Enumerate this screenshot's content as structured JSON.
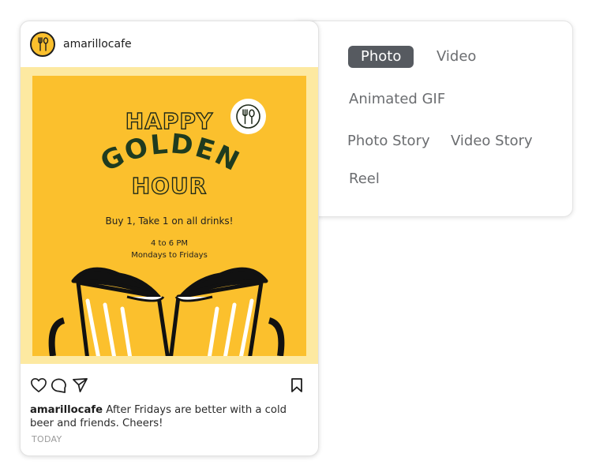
{
  "formats": {
    "options": [
      "Photo",
      "Video",
      "Animated GIF",
      "Photo Story",
      "Video Story",
      "Reel"
    ],
    "selected": "Photo",
    "selected_bg": "#565a60",
    "text_color": "#6b6d70"
  },
  "post": {
    "username": "amarillocafe",
    "avatar_icon": "fork-spoon-icon",
    "image": {
      "line1": "HAPPY",
      "line2": "GOLDEN",
      "line3": "HOUR",
      "offer": "Buy 1, Take 1 on all drinks!",
      "time": "4 to 6 PM",
      "days": "Mondays to Fridays",
      "bg_color": "#fbc02d",
      "frame_color": "#fde9a1"
    },
    "actions": [
      "heart-icon",
      "comment-icon",
      "share-icon",
      "bookmark-icon"
    ],
    "caption_user": "amarillocafe",
    "caption_text": "After Fridays are better with a cold beer and friends. Cheers!",
    "time_ago": "TODAY"
  }
}
